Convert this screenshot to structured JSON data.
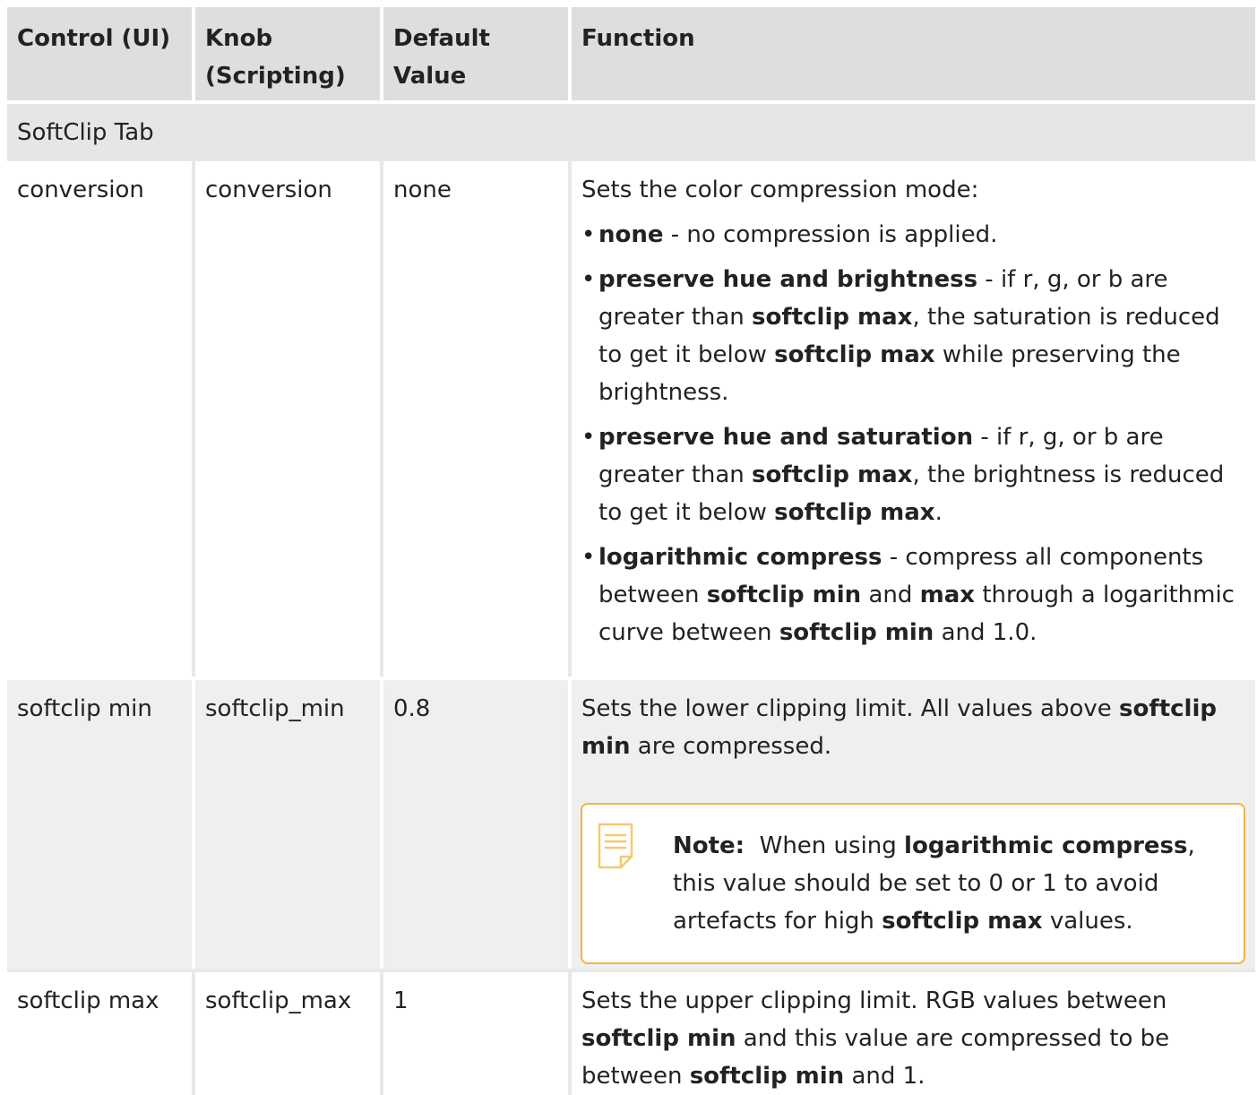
{
  "header": {
    "col1": "Control (UI)",
    "col2_line1": "Knob",
    "col2_line2": "(Scripting)",
    "col3_line1": "Default",
    "col3_line2": "Value",
    "col4": "Function"
  },
  "section": {
    "label": "SoftClip Tab"
  },
  "rows": [
    {
      "control": "conversion",
      "knob": "conversion",
      "default": "none",
      "intro": "Sets the color compression mode:",
      "bullets": [
        {
          "term": "none",
          "text": " - no compression is applied."
        },
        {
          "term": "preserve hue and brightness",
          "t1": " - if r, g, or b are greater than ",
          "b1": "softclip max",
          "t2": ", the saturation is reduced to get it below ",
          "b2": "softclip max",
          "t3": " while preserving the brightness."
        },
        {
          "term": "preserve hue and saturation",
          "t1": " - if r, g, or b are greater than ",
          "b1": "softclip max",
          "t2": ", the brightness is reduced to get it below ",
          "b2": "softclip max",
          "t3": "."
        },
        {
          "term": "logarithmic compress",
          "t1": " - compress all components between ",
          "b1": "softclip min",
          "t2": " and ",
          "b2": "max",
          "t3": " through a logarithmic curve between ",
          "b3": "softclip min",
          "t4": " and 1.0."
        }
      ]
    },
    {
      "control": "softclip min",
      "knob": "softclip_min",
      "default": "0.8",
      "t1": "Sets the lower clipping limit. All values above ",
      "b1": "softclip min",
      "t2": " are compressed.",
      "note": {
        "label": "Note:",
        "t1": "When using ",
        "b1": "logarithmic compress",
        "t2": ", this value should be set to 0 or 1 to avoid artefacts for high ",
        "b2": "softclip max",
        "t3": " values."
      }
    },
    {
      "control": "softclip max",
      "knob": "softclip_max",
      "default": "1",
      "t1": "Sets the upper clipping limit. RGB values between ",
      "b1": "softclip min",
      "t2": " and this value are compressed to be between ",
      "b2": "softclip min",
      "t3": " and 1."
    }
  ],
  "colors": {
    "header_bg": "#dedede",
    "section_bg": "#e6e6e6",
    "row_grey_bg": "#efefef",
    "note_border": "#f2b544"
  },
  "icons": {
    "note": "note-page-icon",
    "bullet": "•"
  }
}
